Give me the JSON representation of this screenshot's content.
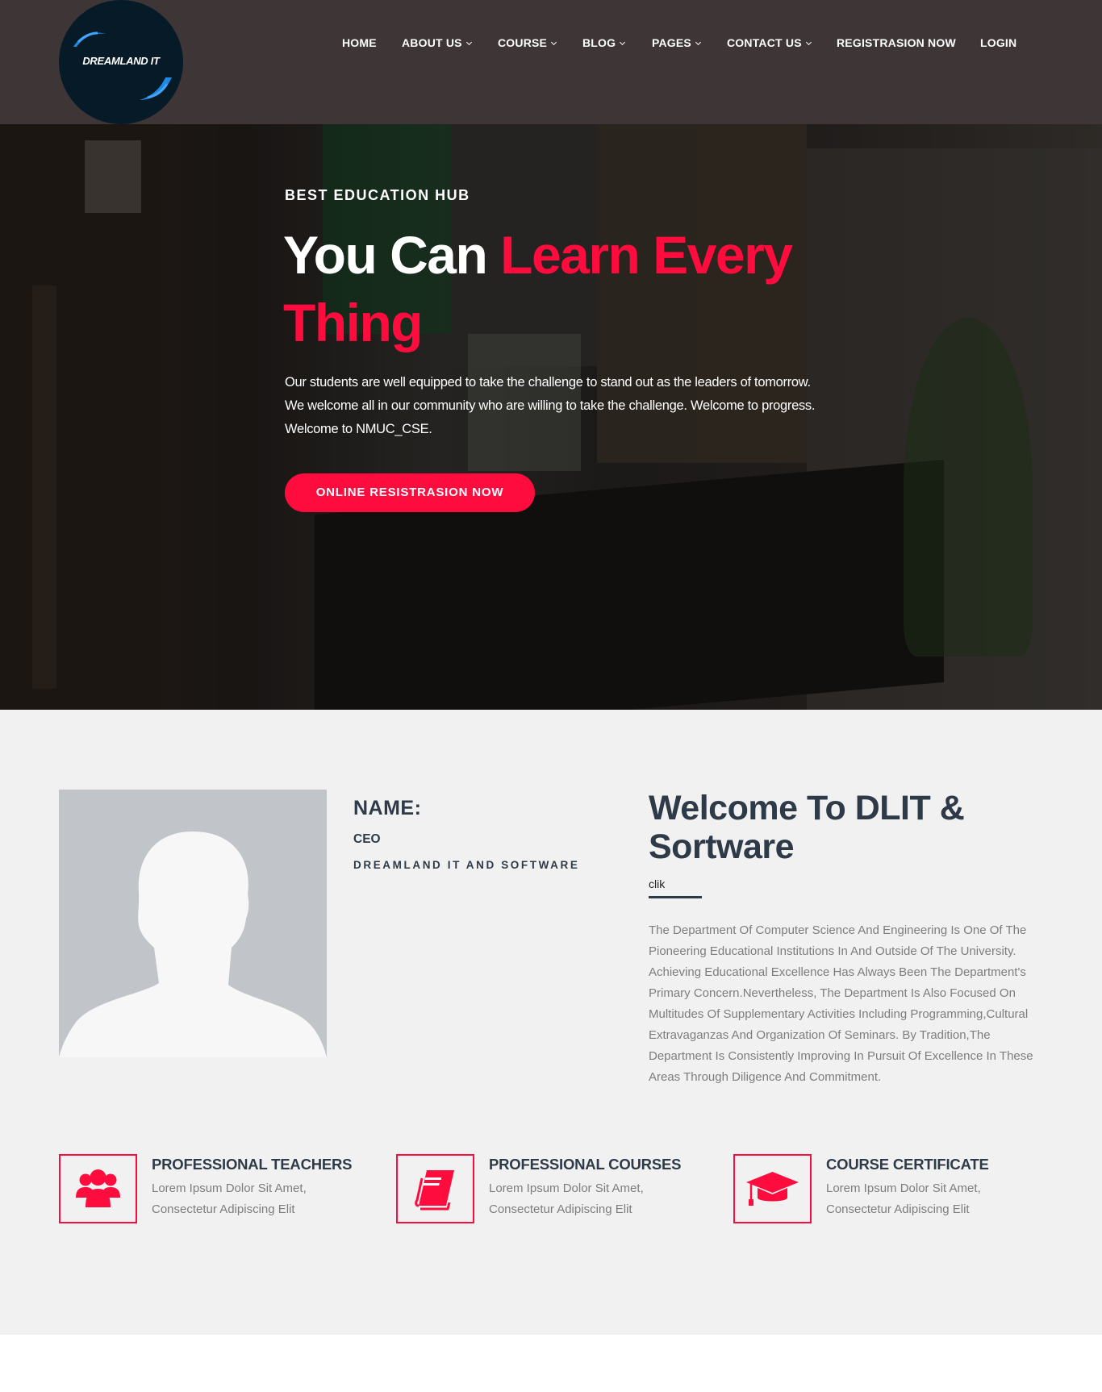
{
  "brand": {
    "logo_text": "DREAMLAND IT",
    "colors": {
      "header_bg": "#3d3536",
      "accent": "#ff0c3e",
      "heading": "#2e3a48",
      "logo_bg": "#071a28",
      "logo_swoosh": "#1e88e5"
    }
  },
  "nav": {
    "items": [
      {
        "label": "HOME",
        "has_dropdown": false
      },
      {
        "label": "ABOUT US",
        "has_dropdown": true
      },
      {
        "label": "COURSE",
        "has_dropdown": true
      },
      {
        "label": "BLOG",
        "has_dropdown": true
      },
      {
        "label": "PAGES",
        "has_dropdown": true
      },
      {
        "label": "CONTACT US",
        "has_dropdown": true
      },
      {
        "label": "REGISTRASION NOW",
        "has_dropdown": false
      },
      {
        "label": "LOGIN",
        "has_dropdown": false
      }
    ]
  },
  "hero": {
    "subtitle": "BEST EDUCATION HUB",
    "title_white": "You Can ",
    "title_accent": "Learn Every Thing",
    "description": "Our students are well equipped to take the challenge to stand out as the leaders of tomorrow. We welcome all in our community who are willing to take the challenge. Welcome to progress. Welcome to NMUC_CSE.",
    "button_label": "ONLINE RESISTRASION NOW"
  },
  "profile": {
    "avatar_icon": "person-silhouette",
    "name_label": "NAME:",
    "role": "CEO",
    "company": "DREAMLAND IT AND SOFTWARE"
  },
  "welcome": {
    "title": "Welcome To DLIT & Sortware",
    "link_label": "clik",
    "body": "The Department Of Computer Science And Engineering Is One Of The Pioneering Educational Institutions In And Outside Of The University. Achieving Educational Excellence Has Always Been The Department's Primary Concern.Nevertheless, The Department Is Also Focused On Multitudes Of Supplementary Activities Including Programming,Cultural Extravaganzas And Organization Of Seminars. By Tradition,The Department Is Consistently Improving In Pursuit Of Excellence In These Areas Through Diligence And Commitment."
  },
  "features": [
    {
      "icon": "users-icon",
      "title": "PROFESSIONAL TEACHERS",
      "text": "Lorem Ipsum Dolor Sit Amet, Consectetur Adipiscing Elit"
    },
    {
      "icon": "book-icon",
      "title": "PROFESSIONAL COURSES",
      "text": "Lorem Ipsum Dolor Sit Amet, Consectetur Adipiscing Elit"
    },
    {
      "icon": "graduation-cap-icon",
      "title": "COURSE CERTIFICATE",
      "text": "Lorem Ipsum Dolor Sit Amet, Consectetur Adipiscing Elit"
    }
  ]
}
